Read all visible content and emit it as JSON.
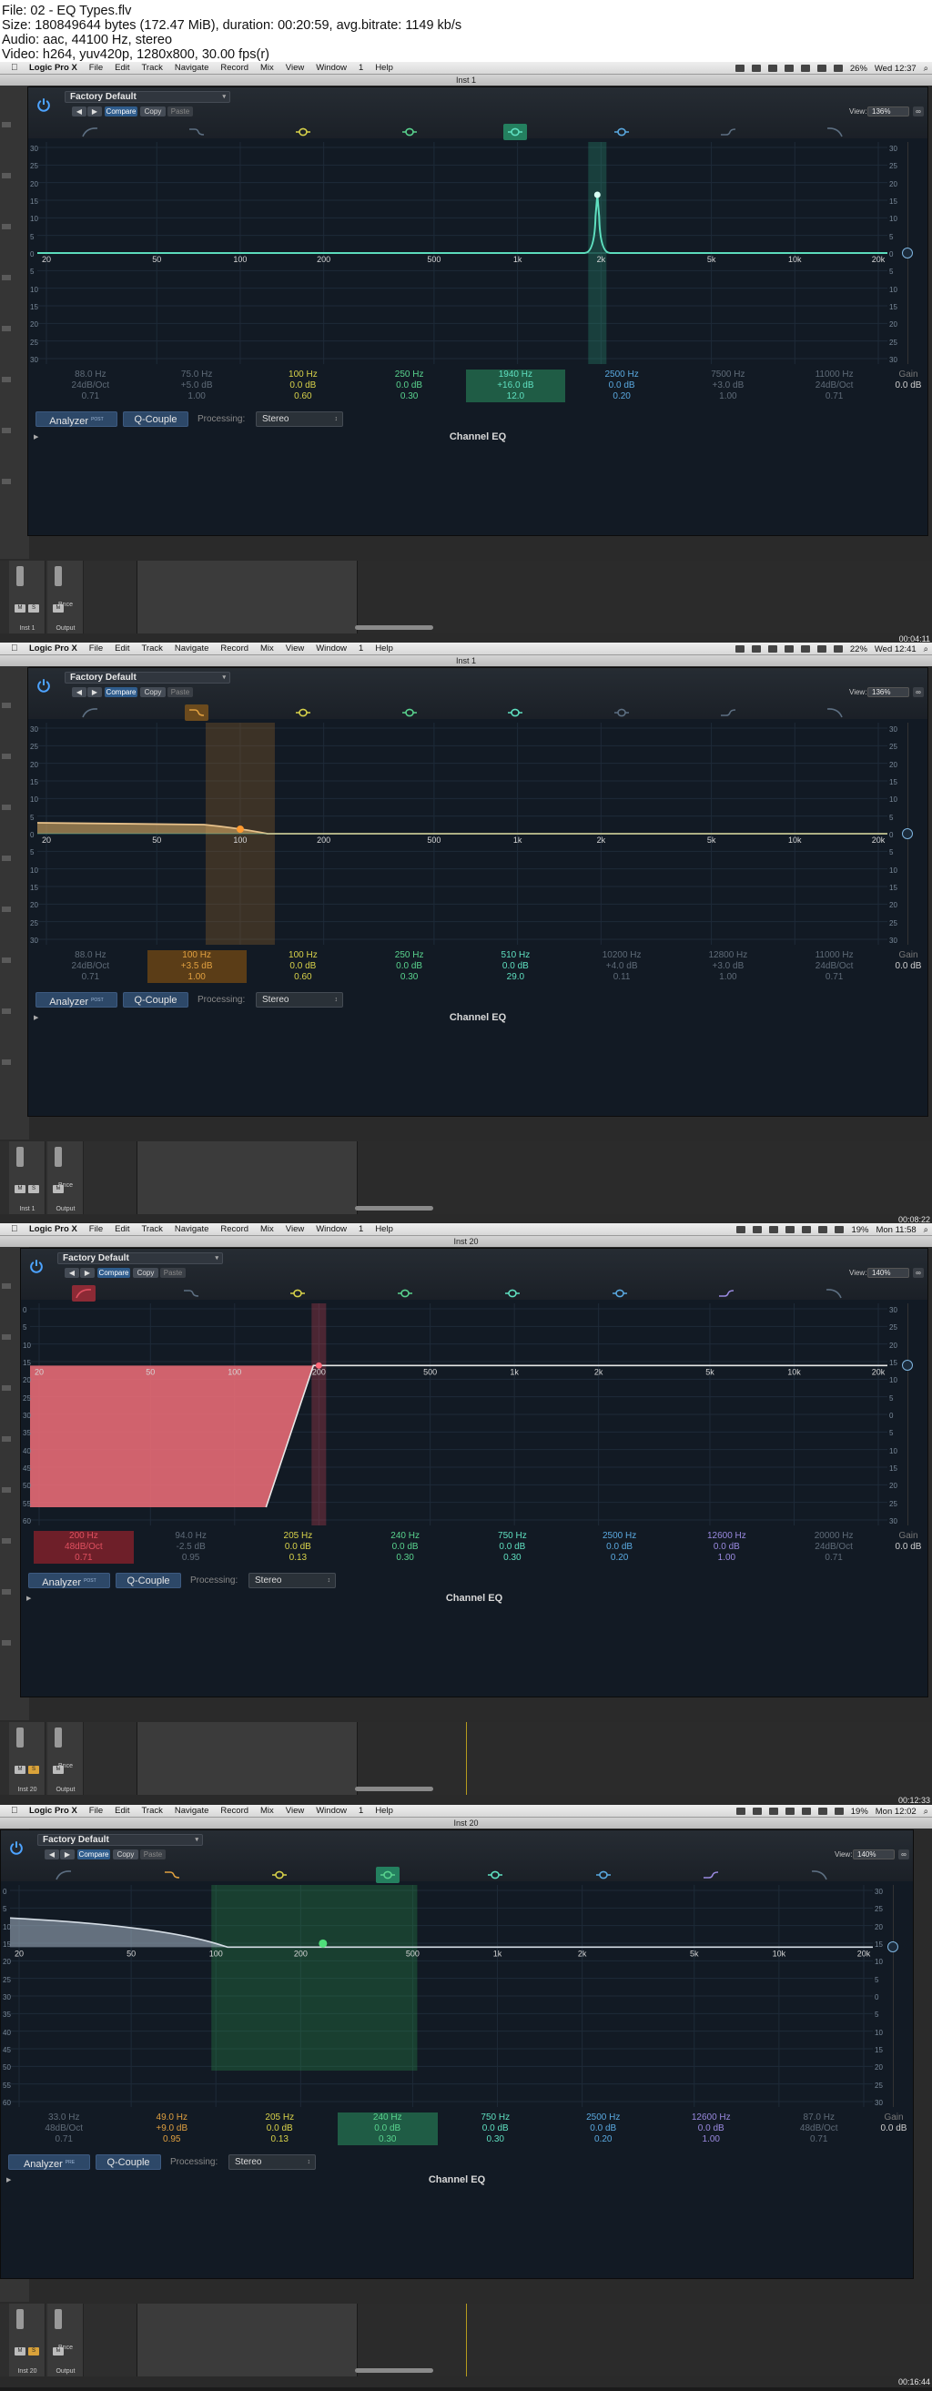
{
  "file_info": {
    "line1": "File: 02 - EQ Types.flv",
    "line2": "Size: 180849644 bytes (172.47 MiB), duration: 00:20:59, avg.bitrate: 1149 kb/s",
    "line3": "Audio: aac, 44100 Hz, stereo",
    "line4": "Video: h264, yuv420p, 1280x800, 30.00 fps(r)"
  },
  "menu": {
    "app": "Logic Pro X",
    "items": [
      "File",
      "Edit",
      "Track",
      "Navigate",
      "Record",
      "Mix",
      "View",
      "Window",
      "1",
      "Help"
    ]
  },
  "eq_common": {
    "compare": "Compare",
    "copy": "Copy",
    "paste": "Paste",
    "view_label": "View:",
    "analyzer": "Analyzer",
    "q_couple": "Q-Couple",
    "processing_label": "Processing:",
    "processing_value": "Stereo",
    "plugin_name": "Channel EQ",
    "gain_label": "Gain",
    "gain_value": "0.0 dB",
    "freq_labels": [
      "20",
      "50",
      "100",
      "200",
      "500",
      "1k",
      "2k",
      "5k",
      "10k",
      "20k"
    ],
    "db_left_a": [
      "30",
      "25",
      "20",
      "15",
      "10",
      "5",
      "0",
      "5",
      "10",
      "15",
      "20",
      "25",
      "30"
    ],
    "db_left_b": [
      "0",
      "5",
      "10",
      "15",
      "20",
      "25",
      "30",
      "35",
      "40",
      "45",
      "50",
      "55",
      "60"
    ],
    "db_right": [
      "30",
      "25",
      "20",
      "15",
      "10",
      "5",
      "0",
      "5",
      "10",
      "15",
      "20",
      "25",
      "30"
    ]
  },
  "frames": [
    {
      "window_title": "Inst 1",
      "clock": "Wed 12:37",
      "battery": "26%",
      "preset": "Factory Default",
      "view_value": "136%",
      "analyzer_mode": "POST",
      "timecode": "00:04:11",
      "strip_labels": [
        "Inst 1",
        "Output"
      ],
      "bounce": "Bnce",
      "mute": "M",
      "solo": "S",
      "bands": [
        {
          "freq": "88.0 Hz",
          "gain": "24dB/Oct",
          "q": "0.71",
          "color": "#5d6f82"
        },
        {
          "freq": "75.0 Hz",
          "gain": "+5.0 dB",
          "q": "1.00",
          "color": "#5d6f82"
        },
        {
          "freq": "100 Hz",
          "gain": "0.0 dB",
          "q": "0.60",
          "color": "#d8d24a"
        },
        {
          "freq": "250 Hz",
          "gain": "0.0 dB",
          "q": "0.30",
          "color": "#59d38e"
        },
        {
          "freq": "1940 Hz",
          "gain": "+16.0 dB",
          "q": "12.0",
          "color": "#5fe0c0"
        },
        {
          "freq": "2500 Hz",
          "gain": "0.0 dB",
          "q": "0.20",
          "color": "#5aa9e0"
        },
        {
          "freq": "7500 Hz",
          "gain": "+3.0 dB",
          "q": "1.00",
          "color": "#5d6f82"
        },
        {
          "freq": "11000 Hz",
          "gain": "24dB/Oct",
          "q": "0.71",
          "color": "#5d6f82"
        }
      ],
      "selected_band": 4
    },
    {
      "window_title": "Inst 1",
      "clock": "Wed 12:41",
      "battery": "22%",
      "preset": "Factory Default",
      "view_value": "136%",
      "analyzer_mode": "POST",
      "timecode": "00:08:22",
      "strip_labels": [
        "Inst 1",
        "Output"
      ],
      "bounce": "Bnce",
      "mute": "M",
      "solo": "S",
      "bands": [
        {
          "freq": "88.0 Hz",
          "gain": "24dB/Oct",
          "q": "0.71",
          "color": "#5d6f82"
        },
        {
          "freq": "100 Hz",
          "gain": "+3.5 dB",
          "q": "1.00",
          "color": "#e0a040"
        },
        {
          "freq": "100 Hz",
          "gain": "0.0 dB",
          "q": "0.60",
          "color": "#d8d24a"
        },
        {
          "freq": "250 Hz",
          "gain": "0.0 dB",
          "q": "0.30",
          "color": "#59d38e"
        },
        {
          "freq": "510 Hz",
          "gain": "0.0 dB",
          "q": "29.0",
          "color": "#5fe0c0"
        },
        {
          "freq": "10200 Hz",
          "gain": "+4.0 dB",
          "q": "0.11",
          "color": "#5d6f82"
        },
        {
          "freq": "12800 Hz",
          "gain": "+3.0 dB",
          "q": "1.00",
          "color": "#5d6f82"
        },
        {
          "freq": "11000 Hz",
          "gain": "24dB/Oct",
          "q": "0.71",
          "color": "#5d6f82"
        }
      ],
      "selected_band": 1
    },
    {
      "window_title": "Inst 20",
      "clock": "Mon 11:58",
      "battery": "19%",
      "preset": "Factory Default",
      "view_value": "140%",
      "analyzer_mode": "POST",
      "timecode": "00:12:33",
      "strip_labels": [
        "Inst 20",
        "Output"
      ],
      "bounce": "Bnce",
      "mute": "M",
      "solo": "S",
      "bands": [
        {
          "freq": "200 Hz",
          "gain": "48dB/Oct",
          "q": "0.71",
          "color": "#e05060"
        },
        {
          "freq": "94.0 Hz",
          "gain": "-2.5 dB",
          "q": "0.95",
          "color": "#5d6f82"
        },
        {
          "freq": "205 Hz",
          "gain": "0.0 dB",
          "q": "0.13",
          "color": "#d8d24a"
        },
        {
          "freq": "240 Hz",
          "gain": "0.0 dB",
          "q": "0.30",
          "color": "#59d38e"
        },
        {
          "freq": "750 Hz",
          "gain": "0.0 dB",
          "q": "0.30",
          "color": "#5fe0c0"
        },
        {
          "freq": "2500 Hz",
          "gain": "0.0 dB",
          "q": "0.20",
          "color": "#5aa9e0"
        },
        {
          "freq": "12600 Hz",
          "gain": "0.0 dB",
          "q": "1.00",
          "color": "#9a8ae0"
        },
        {
          "freq": "20000 Hz",
          "gain": "24dB/Oct",
          "q": "0.71",
          "color": "#5d6f82"
        }
      ],
      "selected_band": 0
    },
    {
      "window_title": "Inst 20",
      "clock": "Mon 12:02",
      "battery": "19%",
      "preset": "Factory Default",
      "view_value": "140%",
      "analyzer_mode": "PRE",
      "timecode": "00:16:44",
      "strip_labels": [
        "Inst 20",
        "Output"
      ],
      "bounce": "Bnce",
      "mute": "M",
      "solo": "S",
      "bands": [
        {
          "freq": "33.0 Hz",
          "gain": "48dB/Oct",
          "q": "0.71",
          "color": "#5d6f82"
        },
        {
          "freq": "49.0 Hz",
          "gain": "+9.0 dB",
          "q": "0.95",
          "color": "#e0a040"
        },
        {
          "freq": "205 Hz",
          "gain": "0.0 dB",
          "q": "0.13",
          "color": "#d8d24a"
        },
        {
          "freq": "240 Hz",
          "gain": "0.0 dB",
          "q": "0.30",
          "color": "#59d38e"
        },
        {
          "freq": "750 Hz",
          "gain": "0.0 dB",
          "q": "0.30",
          "color": "#5fe0c0"
        },
        {
          "freq": "2500 Hz",
          "gain": "0.0 dB",
          "q": "0.20",
          "color": "#5aa9e0"
        },
        {
          "freq": "12600 Hz",
          "gain": "0.0 dB",
          "q": "1.00",
          "color": "#9a8ae0"
        },
        {
          "freq": "87.0 Hz",
          "gain": "48dB/Oct",
          "q": "0.71",
          "color": "#5d6f82"
        }
      ],
      "selected_band": 3
    }
  ]
}
